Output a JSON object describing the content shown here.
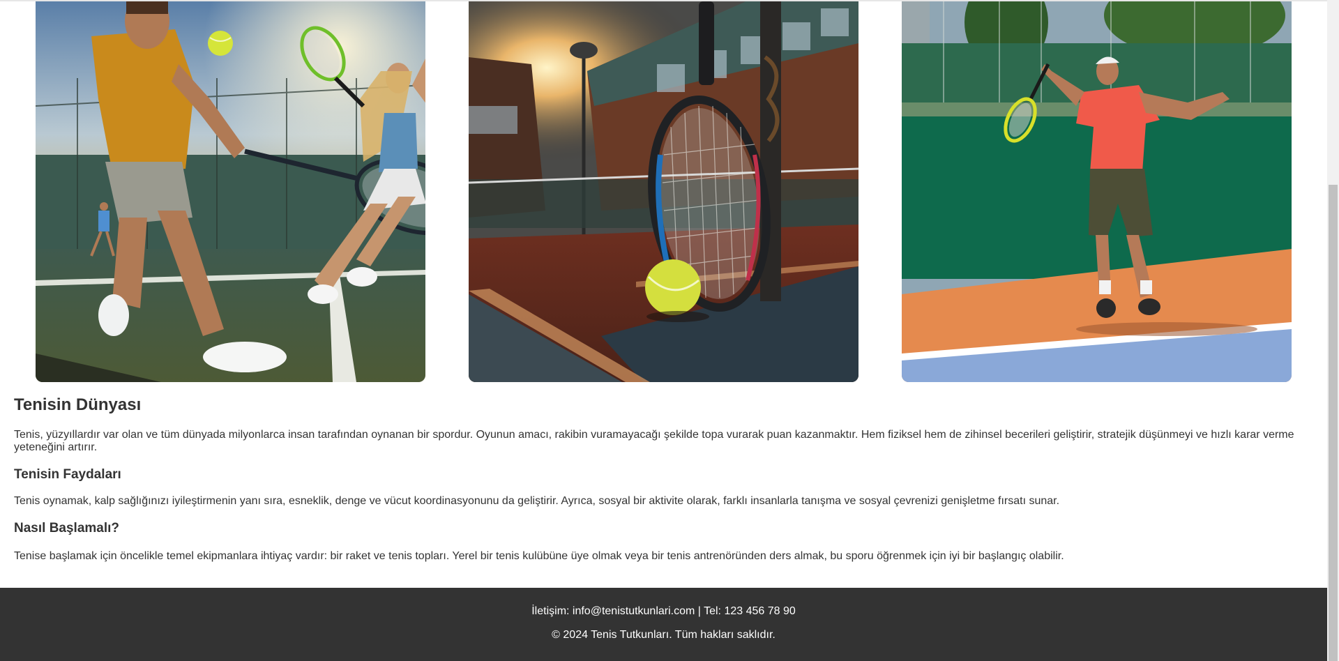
{
  "gallery": {
    "images": [
      {
        "alt": "tennis-players-hard-court"
      },
      {
        "alt": "racket-and-ball-at-sunset"
      },
      {
        "alt": "player-serving-on-clay"
      }
    ]
  },
  "article": {
    "title": "Tenisin Dünyası",
    "intro": "Tenis, yüzyıllardır var olan ve tüm dünyada milyonlarca insan tarafından oynanan bir spordur. Oyunun amacı, rakibin vuramayacağı şekilde topa vurarak puan kazanmaktır. Hem fiziksel hem de zihinsel becerileri geliştirir, stratejik düşünmeyi ve hızlı karar verme yeteneğini artırır.",
    "benefits_heading": "Tenisin Faydaları",
    "benefits_text": "Tenis oynamak, kalp sağlığınızı iyileştirmenin yanı sıra, esneklik, denge ve vücut koordinasyonunu da geliştirir. Ayrıca, sosyal bir aktivite olarak, farklı insanlarla tanışma ve sosyal çevrenizi genişletme fırsatı sunar.",
    "start_heading": "Nasıl Başlamalı?",
    "start_text": "Tenise başlamak için öncelikle temel ekipmanlara ihtiyaç vardır: bir raket ve tenis topları. Yerel bir tenis kulübüne üye olmak veya bir tenis antrenöründen ders almak, bu sporu öğrenmek için iyi bir başlangıç olabilir."
  },
  "footer": {
    "contact": "İletişim: info@tenistutkunlari.com | Tel: 123 456 78 90",
    "copyright": "© 2024 Tenis Tutkunları. Tüm hakları saklıdır."
  },
  "colors": {
    "footer_bg": "#333333",
    "text": "#333333",
    "scroll_track": "#f1f1f1",
    "scroll_thumb": "#c1c1c1"
  }
}
